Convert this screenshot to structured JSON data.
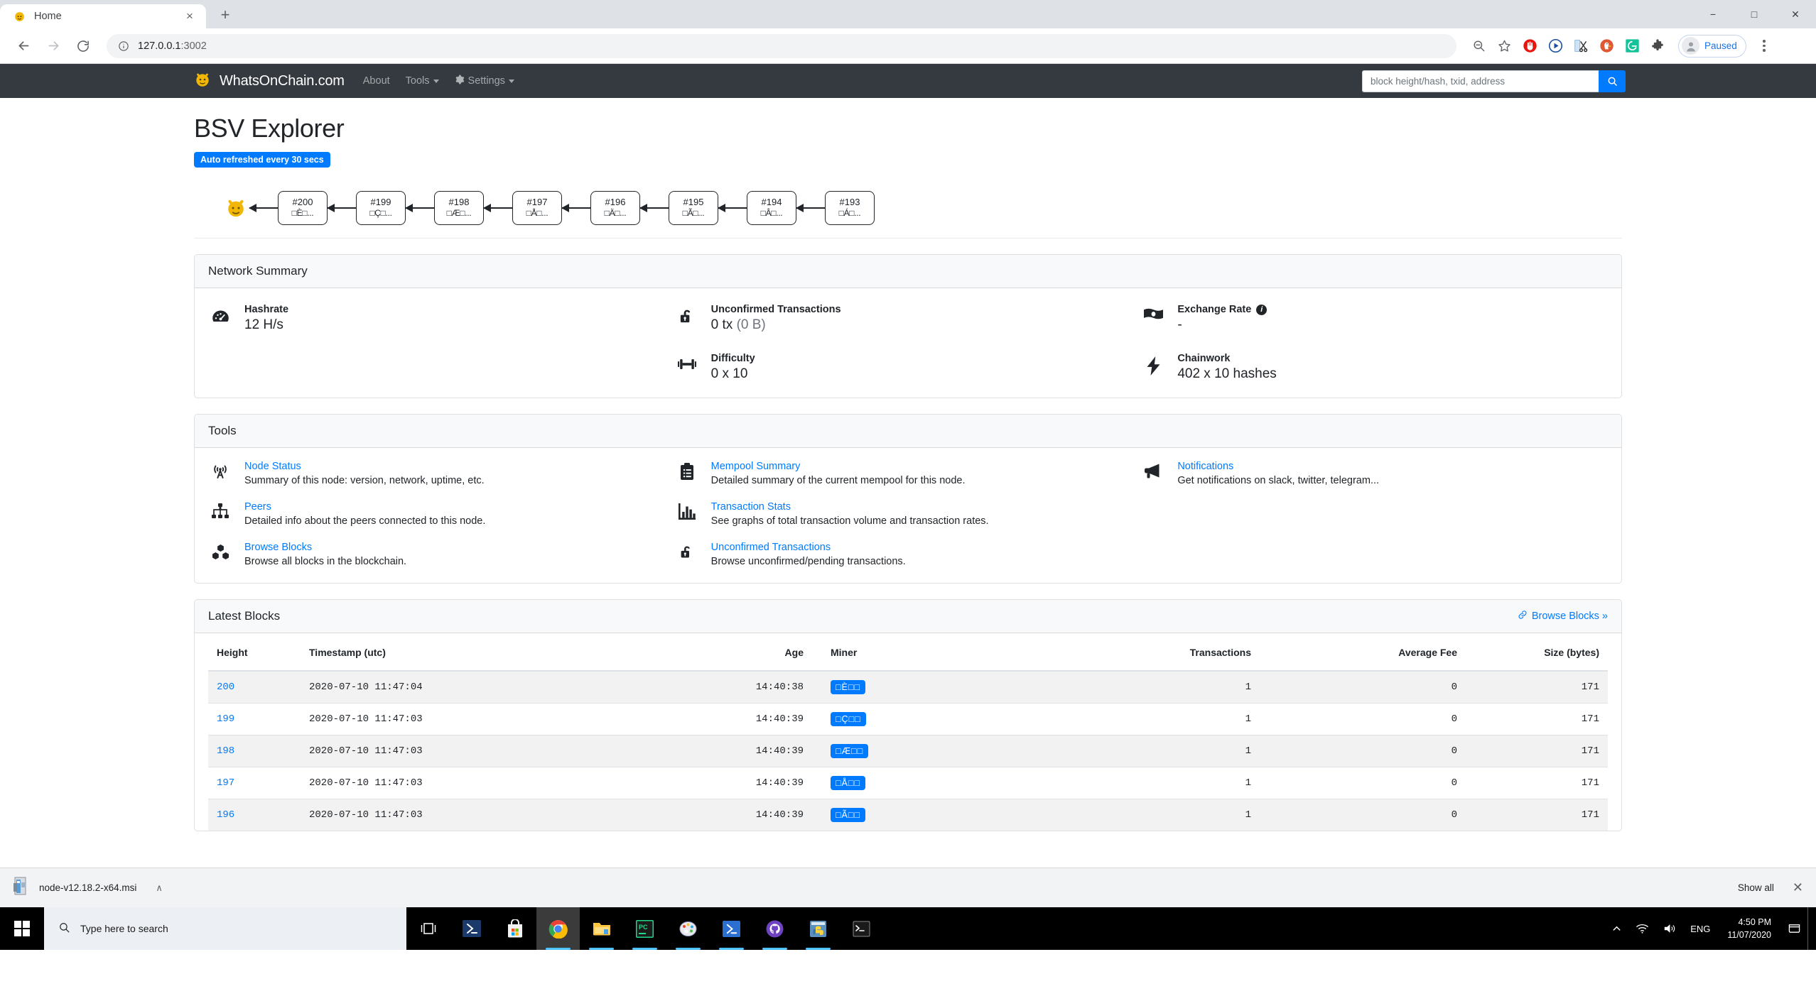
{
  "browser": {
    "tab": {
      "title": "Home",
      "favicon": "whatsonchain-tiger-icon",
      "close_label": "×"
    },
    "new_tab_label": "+",
    "window_controls": {
      "minimize": "−",
      "maximize": "□",
      "close": "✕"
    },
    "nav": {
      "back": "←",
      "forward": "→",
      "reload": "⟳"
    },
    "omnibox": {
      "url_host": "127.0.0.1",
      "url_port": ":3002",
      "info_icon": "site-info-icon"
    },
    "extensions": [
      {
        "name": "zoom-search-icon"
      },
      {
        "name": "bookmark-star-icon"
      },
      {
        "name": "adblock-icon"
      },
      {
        "name": "video-player-icon"
      },
      {
        "name": "snip-scissors-icon"
      },
      {
        "name": "duckduckgo-icon"
      },
      {
        "name": "grammarly-icon"
      },
      {
        "name": "extensions-puzzle-icon"
      }
    ],
    "profile": {
      "label": "Paused"
    }
  },
  "site": {
    "brand": "WhatsOnChain.com",
    "nav": [
      {
        "label": "About",
        "caret": false,
        "gear": false
      },
      {
        "label": "Tools",
        "caret": true,
        "gear": false
      },
      {
        "label": "Settings",
        "caret": true,
        "gear": true
      }
    ],
    "search": {
      "placeholder": "block height/hash, txid, address",
      "button_icon": "search-icon"
    }
  },
  "main": {
    "title": "BSV Explorer",
    "refresh_badge": "Auto refreshed every 30 secs",
    "chain": [
      {
        "height": "#200",
        "hash": "□È□..."
      },
      {
        "height": "#199",
        "hash": "□Ç□..."
      },
      {
        "height": "#198",
        "hash": "□Æ□..."
      },
      {
        "height": "#197",
        "hash": "□Å□..."
      },
      {
        "height": "#196",
        "hash": "□Ä□..."
      },
      {
        "height": "#195",
        "hash": "□Ã□..."
      },
      {
        "height": "#194",
        "hash": "□Â□..."
      },
      {
        "height": "#193",
        "hash": "□Á□..."
      }
    ]
  },
  "network_summary": {
    "title": "Network Summary",
    "col1": [
      {
        "icon": "tachometer-icon",
        "label": "Hashrate",
        "value": "12 H/s",
        "muted": ""
      }
    ],
    "col2": [
      {
        "icon": "unlock-icon",
        "label": "Unconfirmed Transactions",
        "value": "0 tx ",
        "muted": "(0 B)"
      },
      {
        "icon": "weight-icon",
        "label": "Difficulty",
        "value": "0 x 10",
        "muted": ""
      }
    ],
    "col3": [
      {
        "icon": "money-bill-icon",
        "label": "Exchange Rate",
        "value": "-",
        "muted": "",
        "info": true
      },
      {
        "icon": "bolt-icon",
        "label": "Chainwork",
        "value": "402 x 10 hashes",
        "muted": ""
      }
    ]
  },
  "tools": {
    "title": "Tools",
    "col1": [
      {
        "icon": "broadcast-tower-icon",
        "title": "Node Status",
        "desc": "Summary of this node: version, network, uptime, etc."
      },
      {
        "icon": "sitemap-icon",
        "title": "Peers",
        "desc": "Detailed info about the peers connected to this node."
      },
      {
        "icon": "cubes-icon",
        "title": "Browse Blocks",
        "desc": "Browse all blocks in the blockchain."
      }
    ],
    "col2": [
      {
        "icon": "clipboard-list-icon",
        "title": "Mempool Summary",
        "desc": "Detailed summary of the current mempool for this node."
      },
      {
        "icon": "chart-bar-icon",
        "title": "Transaction Stats",
        "desc": "See graphs of total transaction volume and transaction rates."
      },
      {
        "icon": "unlock-icon",
        "title": "Unconfirmed Transactions",
        "desc": "Browse unconfirmed/pending transactions."
      }
    ],
    "col3": [
      {
        "icon": "bullhorn-icon",
        "title": "Notifications",
        "desc": "Get notifications on slack, twitter, telegram..."
      }
    ]
  },
  "latest_blocks": {
    "title": "Latest Blocks",
    "browse_link": "Browse Blocks »",
    "columns": [
      "Height",
      "Timestamp (utc)",
      "Age",
      "Miner",
      "Transactions",
      "Average Fee",
      "Size (bytes)"
    ],
    "rows": [
      {
        "height": "200",
        "timestamp": "2020-07-10 11:47:04",
        "age": "14:40:38",
        "miner": "□È□□",
        "transactions": "1",
        "average_fee": "0",
        "size": "171"
      },
      {
        "height": "199",
        "timestamp": "2020-07-10 11:47:03",
        "age": "14:40:39",
        "miner": "□Ç□□",
        "transactions": "1",
        "average_fee": "0",
        "size": "171"
      },
      {
        "height": "198",
        "timestamp": "2020-07-10 11:47:03",
        "age": "14:40:39",
        "miner": "□Æ□□",
        "transactions": "1",
        "average_fee": "0",
        "size": "171"
      },
      {
        "height": "197",
        "timestamp": "2020-07-10 11:47:03",
        "age": "14:40:39",
        "miner": "□Å□□",
        "transactions": "1",
        "average_fee": "0",
        "size": "171"
      },
      {
        "height": "196",
        "timestamp": "2020-07-10 11:47:03",
        "age": "14:40:39",
        "miner": "□Ã□□",
        "transactions": "1",
        "average_fee": "0",
        "size": "171"
      }
    ]
  },
  "download_bar": {
    "file_name": "node-v12.18.2-x64.msi",
    "caret": "∧",
    "show_all": "Show all",
    "close": "✕"
  },
  "taskbar": {
    "search_placeholder": "Type here to search",
    "language": "ENG",
    "time": "4:50 PM",
    "date": "11/07/2020",
    "apps": [
      {
        "name": "task-view-icon"
      },
      {
        "name": "powershell-icon"
      },
      {
        "name": "microsoft-store-icon"
      },
      {
        "name": "google-chrome-icon"
      },
      {
        "name": "file-explorer-icon"
      },
      {
        "name": "pycharm-icon"
      },
      {
        "name": "paint-icon"
      },
      {
        "name": "windows-terminal-icon"
      },
      {
        "name": "github-desktop-icon"
      },
      {
        "name": "python-idle-icon"
      },
      {
        "name": "command-prompt-icon"
      }
    ]
  },
  "colors": {
    "accent_blue": "#007bff",
    "header_dark": "#343a40",
    "link_blue": "#1a73e8",
    "brand_yellow": "#f2b705"
  }
}
